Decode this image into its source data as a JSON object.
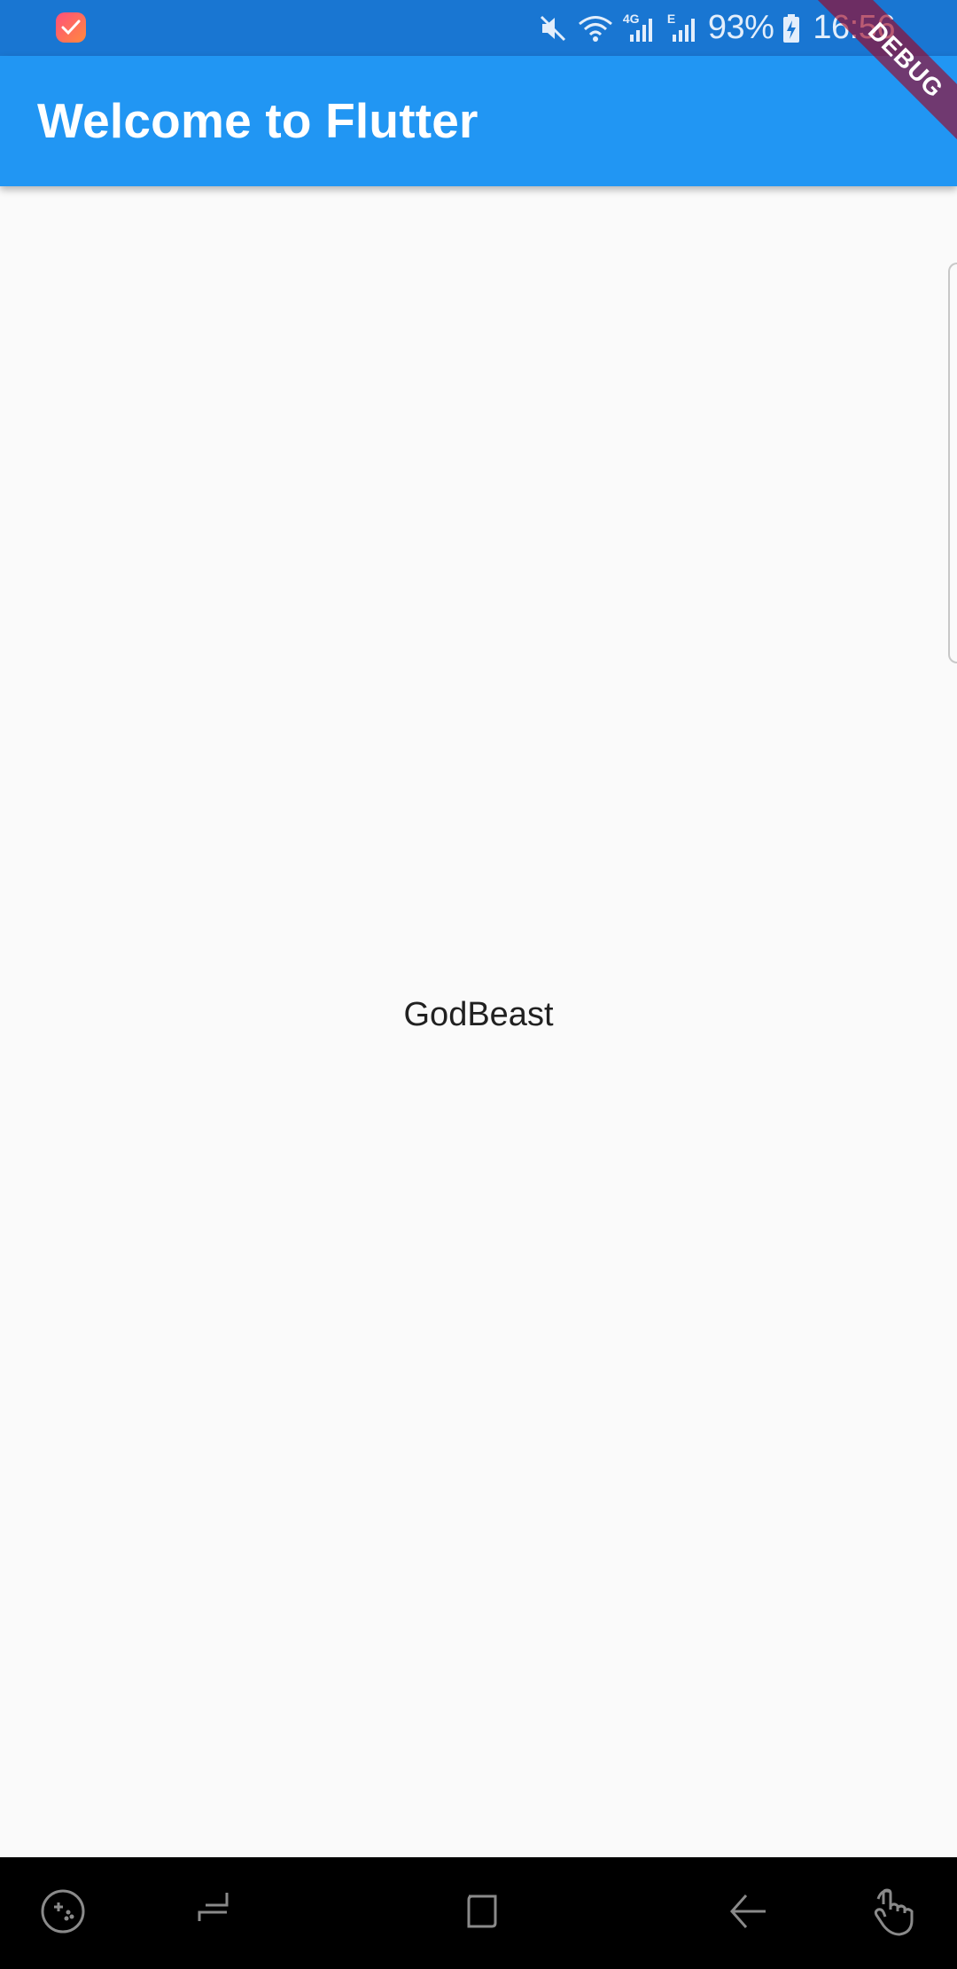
{
  "status_bar": {
    "notification_icon": "task-app-icon",
    "icons": [
      "mute-icon",
      "wifi-icon",
      "signal-4g-icon",
      "signal-e-icon",
      "battery-charging-icon"
    ],
    "network_4g": "4G",
    "network_e": "E",
    "battery_percent": "93%",
    "time": "16:56"
  },
  "app_bar": {
    "title": "Welcome to Flutter",
    "background_color": "#2196f3"
  },
  "debug_banner": {
    "label": "DEBUG"
  },
  "body": {
    "text": "GodBeast"
  },
  "nav_bar": {
    "buttons": [
      "game-tools-icon",
      "recent-apps-icon",
      "home-icon",
      "back-icon",
      "assistive-touch-icon"
    ]
  }
}
